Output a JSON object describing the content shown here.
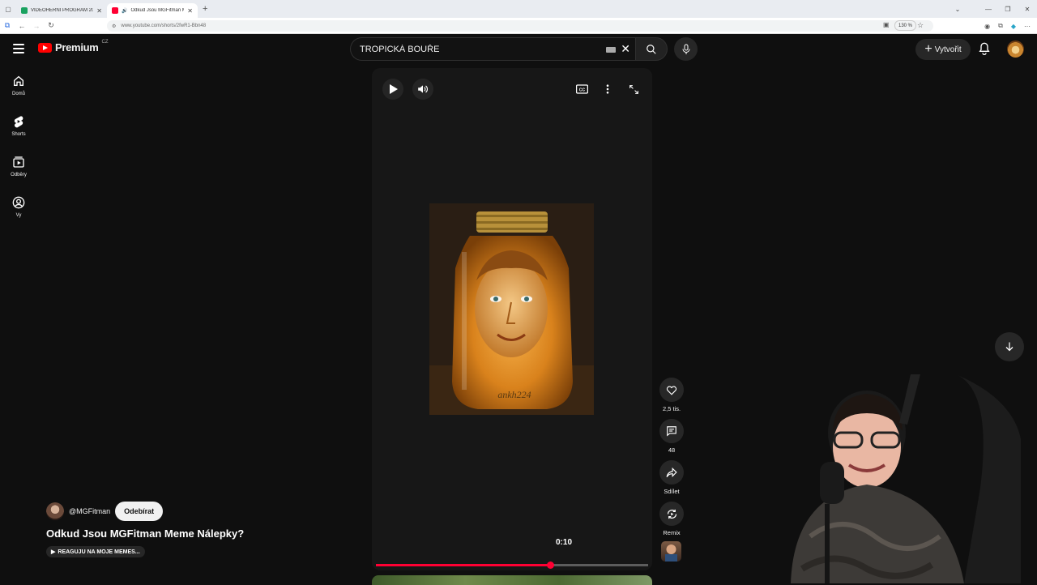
{
  "browser": {
    "tabs": [
      {
        "title": "VIDEOHERNÍ PROGRAM 2026 -",
        "active": false,
        "favicon_color": "#1aa260"
      },
      {
        "title": "Odkud Jsou MGFitman Me",
        "active": true,
        "favicon_color": "#ff0033"
      }
    ],
    "url": "www.youtube.com/shorts/2fwR1-Bbn48",
    "zoom": "130 %"
  },
  "masthead": {
    "logo_text": "Premium",
    "country_code": "CZ",
    "search_value": "TROPICKÁ BOUŘE",
    "create_label": "Vytvořit"
  },
  "guide": {
    "items": [
      {
        "label": "Domů",
        "icon": "home-icon"
      },
      {
        "label": "Shorts",
        "icon": "shorts-icon"
      },
      {
        "label": "Odběry",
        "icon": "subscriptions-icon"
      },
      {
        "label": "Vy",
        "icon": "you-icon"
      }
    ]
  },
  "player": {
    "current_time": "0:10",
    "progress_fraction": 0.64,
    "watermark": "ankh224"
  },
  "actions": {
    "likes": "2,5 tis.",
    "comments": "48",
    "share_label": "Sdílet",
    "remix_label": "Remix"
  },
  "video": {
    "channel": "@MGFitman",
    "subscribe_label": "Odebírat",
    "title": "Odkud Jsou MGFitman Meme Nálepky?",
    "related_label": "REAGUJU NA MOJE MEMES..."
  },
  "colors": {
    "accent": "#ff0033",
    "background": "#0f0f0f",
    "surface": "#272727"
  }
}
